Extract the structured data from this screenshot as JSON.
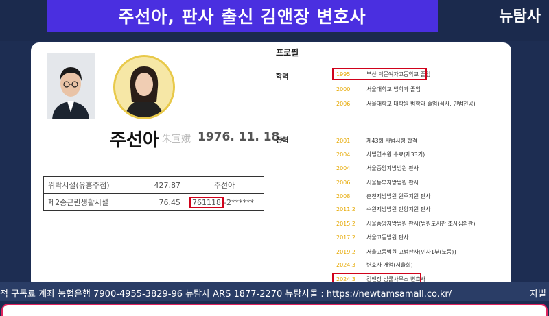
{
  "header": {
    "title": "주선아, 판사 출신 김앤장 변호사",
    "brand": "뉴탐사"
  },
  "person": {
    "name": "주선아",
    "hanja": "朱宣娥",
    "birth": "1976. 11. 18."
  },
  "table": {
    "rows": [
      {
        "label": "위락시설(유흥주점)",
        "area": "427.87",
        "owner": "주선아"
      },
      {
        "label": "제2종근린생활시설",
        "area": "76.45",
        "code_highlight": "761118",
        "code_rest": "-2******"
      }
    ]
  },
  "profile": {
    "title": "프로필",
    "education_label": "학력",
    "career_label": "경력",
    "education": [
      {
        "year": "1995",
        "text": "부산 덕문여자고등학교 졸업"
      },
      {
        "year": "2000",
        "text": "서울대학교 법학과 졸업"
      },
      {
        "year": "2006",
        "text": "서울대학교 대학원 법학과 졸업(석사, 민법전공)"
      }
    ],
    "career": [
      {
        "year": "2001",
        "text": "제43회 사법시험 합격"
      },
      {
        "year": "2004",
        "text": "사법연수원 수료(제33기)"
      },
      {
        "year": "2004",
        "text": "서울중앙지방법원 판사"
      },
      {
        "year": "2006",
        "text": "서울동부지방법원 판사"
      },
      {
        "year": "2008",
        "text": "춘천지방법원 원주지원 판사"
      },
      {
        "year": "2011.2",
        "text": "수원지방법원 안양지원 판사"
      },
      {
        "year": "2015.2",
        "text": "서울중앙지방법원 판사(법원도서관 조사심의관)"
      },
      {
        "year": "2017.2",
        "text": "서울고등법원 판사"
      },
      {
        "year": "2019.2",
        "text": "서울고등법원 고법판사[민사1부(노동)]"
      },
      {
        "year": "2024.3",
        "text": "변호사 개업(서울회)"
      },
      {
        "year": "2024.3",
        "text": "김앤장 법률사무소 변호사"
      }
    ]
  },
  "ticker": {
    "text": "적 구독료 계좌 농협은행 7900-4955-3829-96   뉴탐사 ARS 1877-2270   뉴탐사몰 : https://newtamsamall.co.kr/",
    "right": "자빌"
  },
  "colors": {
    "title_bg": "#4a2fe0",
    "highlight": "#d0021b",
    "year": "#e6a800"
  }
}
